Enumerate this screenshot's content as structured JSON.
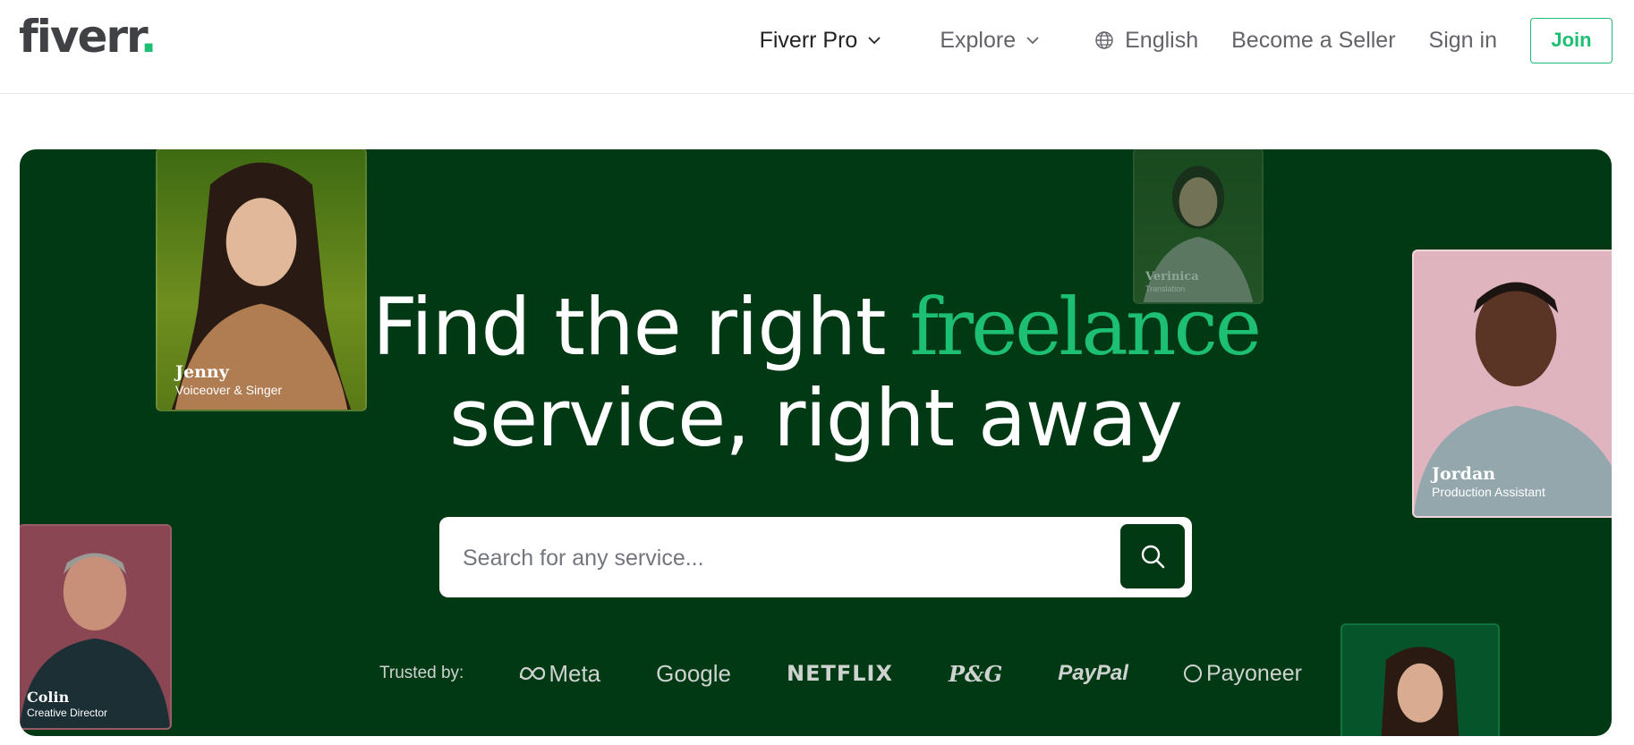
{
  "header": {
    "logo_text": "fiverr",
    "logo_dot": ".",
    "nav": {
      "fiverr_pro": "Fiverr Pro",
      "explore": "Explore",
      "language": "English",
      "become_seller": "Become a Seller",
      "sign_in": "Sign in",
      "join": "Join"
    }
  },
  "hero": {
    "headline_part1": "Find the right",
    "headline_accent": "freelance",
    "headline_part2": "service, right away",
    "search_placeholder": "Search for any service...",
    "trusted_label": "Trusted by:",
    "brands": [
      "Meta",
      "Google",
      "NETFLIX",
      "P&G",
      "PayPal",
      "Payoneer"
    ],
    "freelancers": [
      {
        "name": "Jenny",
        "role": "Voiceover & Singer"
      },
      {
        "name": "Verinica",
        "role": "Translation"
      },
      {
        "name": "Jordan",
        "role": "Production Assistant"
      },
      {
        "name": "Colin",
        "role": "Creative Director"
      }
    ]
  },
  "colors": {
    "brand_green": "#1dbf73",
    "hero_bg": "#013914",
    "text_dark": "#404145"
  },
  "icons": [
    "chevron-down-icon",
    "globe-icon",
    "search-icon",
    "meta-infinity-icon",
    "payoneer-ring-icon"
  ]
}
